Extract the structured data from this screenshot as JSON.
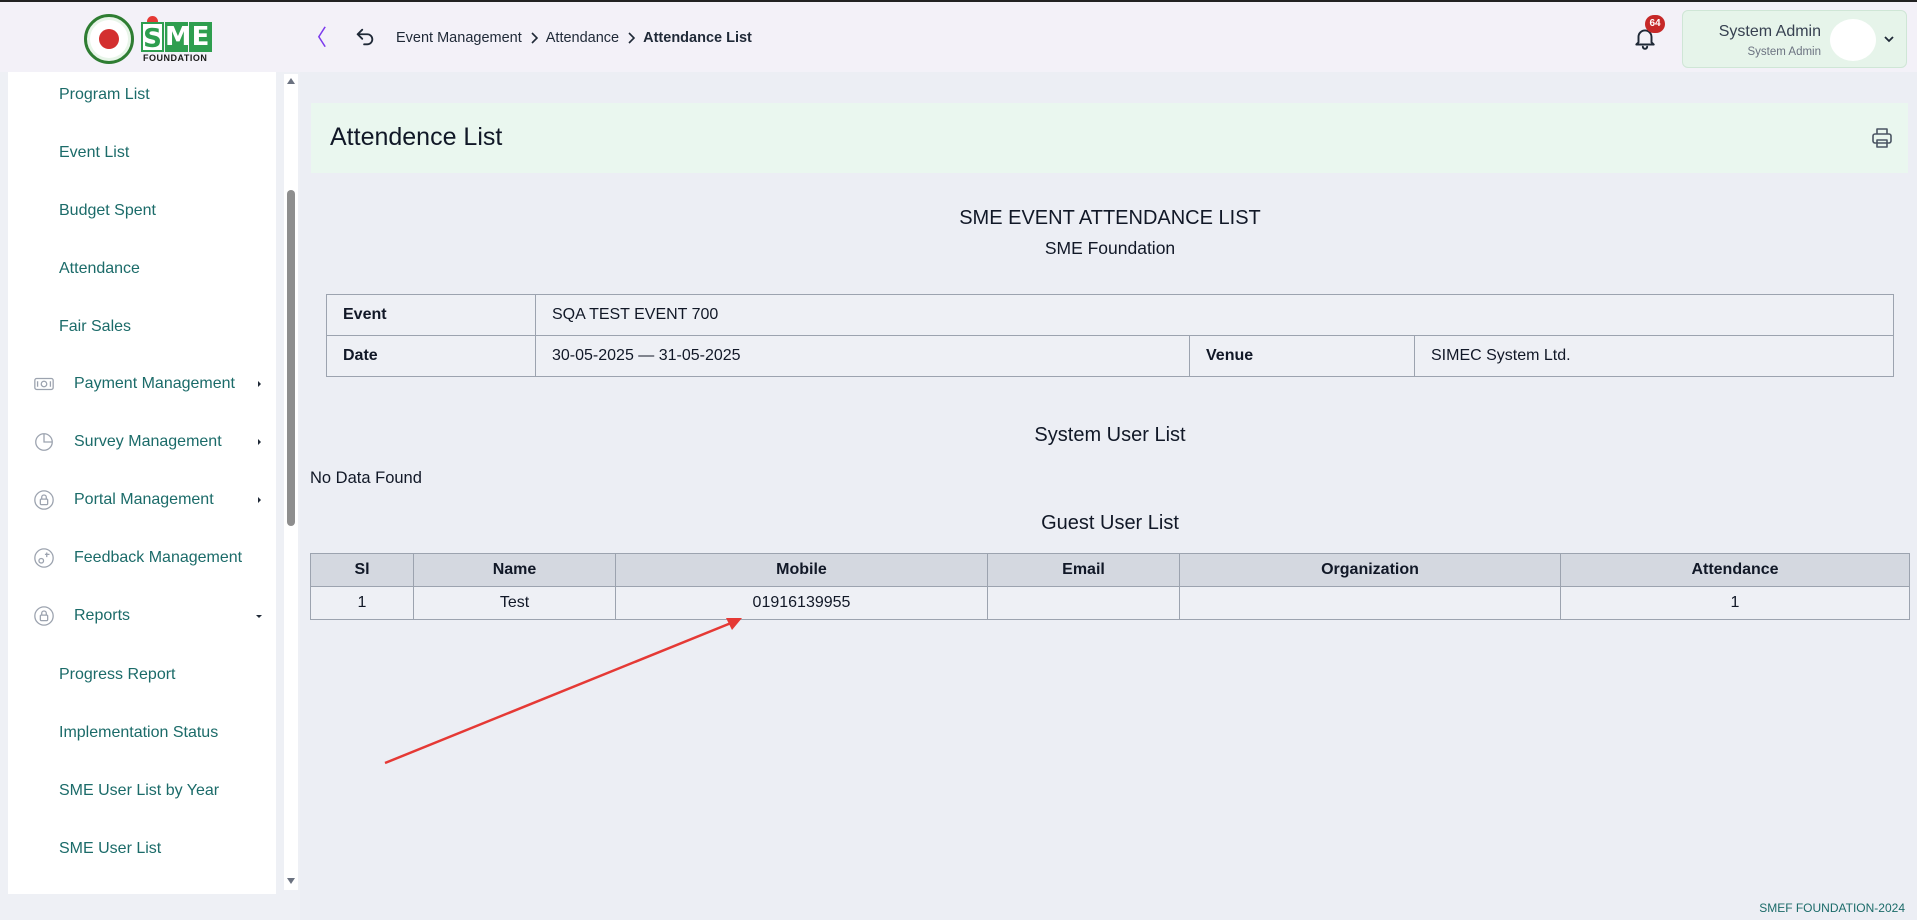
{
  "header": {
    "logo_caption": "FOUNDATION",
    "breadcrumb": [
      "Event Management",
      "Attendance",
      "Attendance List"
    ],
    "notification_count": "64",
    "user": {
      "name": "System Admin",
      "role": "System Admin"
    }
  },
  "sidebar": {
    "items": [
      {
        "label": "Program List"
      },
      {
        "label": "Event List"
      },
      {
        "label": "Budget Spent"
      },
      {
        "label": "Attendance"
      },
      {
        "label": "Fair Sales"
      },
      {
        "label": "Payment Management",
        "icon": "payment-icon",
        "expandable": true
      },
      {
        "label": "Survey Management",
        "icon": "survey-icon",
        "expandable": true
      },
      {
        "label": "Portal Management",
        "icon": "lock-icon",
        "expandable": true
      },
      {
        "label": "Feedback Management",
        "icon": "feedback-icon"
      },
      {
        "label": "Reports",
        "icon": "lock-icon",
        "expandable": true,
        "expanded": true
      },
      {
        "label": "Progress Report"
      },
      {
        "label": "Implementation Status"
      },
      {
        "label": "SME User List by Year"
      },
      {
        "label": "SME User List"
      }
    ]
  },
  "page": {
    "title": "Attendence List",
    "report_title": "SME EVENT ATTENDANCE LIST",
    "report_subtitle": "SME Foundation",
    "event_info": {
      "event_label": "Event",
      "event_value": "SQA TEST EVENT 700",
      "date_label": "Date",
      "date_value": "30-05-2025 — 31-05-2025",
      "venue_label": "Venue",
      "venue_value": "SIMEC System Ltd."
    },
    "system_users": {
      "title": "System User List",
      "empty_text": "No Data Found"
    },
    "guest_users": {
      "title": "Guest User List",
      "columns": [
        "Sl",
        "Name",
        "Mobile",
        "Email",
        "Organization",
        "Attendance"
      ],
      "rows": [
        [
          "1",
          "Test",
          "01916139955",
          "",
          "",
          "1"
        ]
      ]
    }
  },
  "footer": {
    "text": "SMEF FOUNDATION-2024"
  },
  "colors": {
    "accent_teal": "#1b6b69",
    "brand_green": "#2e9e4f",
    "header_bg": "#eaf7ef",
    "badge_red": "#c62828",
    "annotation_arrow": "#e53935"
  }
}
